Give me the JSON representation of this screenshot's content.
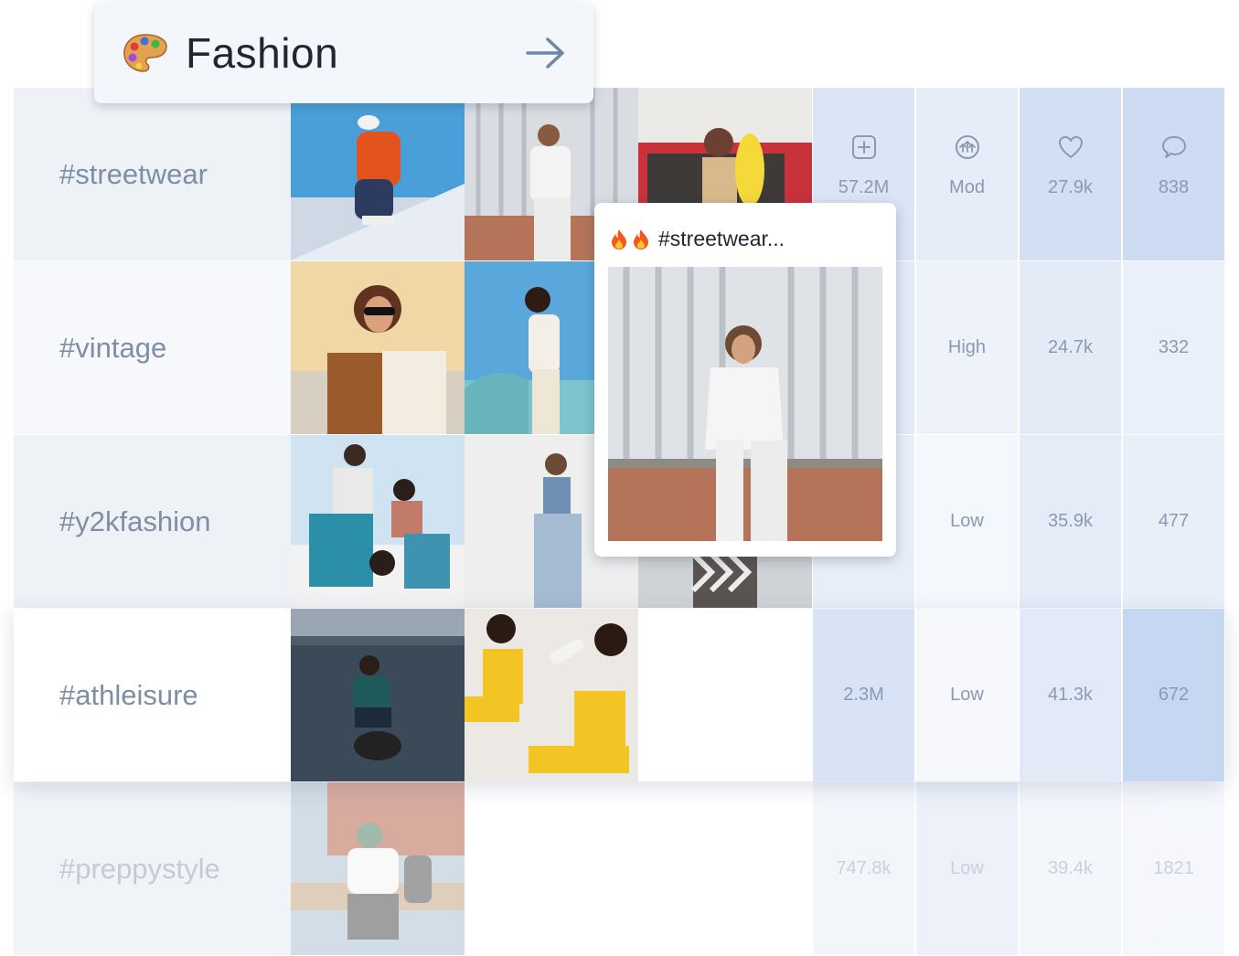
{
  "header": {
    "title": "Fashion",
    "icon": "palette-icon",
    "action_icon": "arrow-right-icon"
  },
  "popup": {
    "title": "#streetwear...",
    "emoji": "🔥🔥",
    "icon": "fire-icon"
  },
  "stat_icons": [
    "plus-square-icon",
    "moderation-icon",
    "heart-icon",
    "comment-icon"
  ],
  "rows": [
    {
      "hashtag": "#streetwear",
      "posts": "57.2M",
      "competition": "Mod",
      "likes": "27.9k",
      "comments": "838"
    },
    {
      "hashtag": "#vintage",
      "posts": "",
      "competition": "High",
      "likes": "24.7k",
      "comments": "332"
    },
    {
      "hashtag": "#y2kfashion",
      "posts": "",
      "competition": "Low",
      "likes": "35.9k",
      "comments": "477"
    },
    {
      "hashtag": "#athleisure",
      "posts": "2.3M",
      "competition": "Low",
      "likes": "41.3k",
      "comments": "672"
    },
    {
      "hashtag": "#preppystyle",
      "posts": "747.8k",
      "competition": "Low",
      "likes": "39.4k",
      "comments": "1821"
    }
  ],
  "colors": {
    "stat_col_1": "#dbe5f5",
    "stat_col_2": "#e6edf8",
    "stat_col_3": "#d3e0f4",
    "stat_col_4": "#cddcf3",
    "tag_text": "#7d8ea6",
    "title_text": "#1f2733"
  }
}
